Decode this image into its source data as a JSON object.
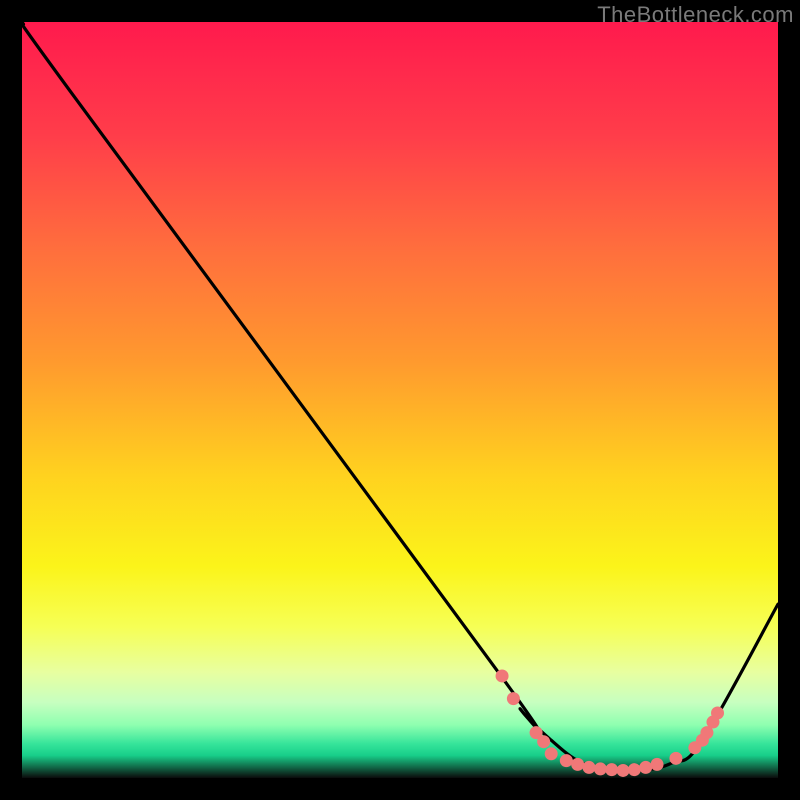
{
  "watermark": "TheBottleneck.com",
  "chart_data": {
    "type": "line",
    "title": "",
    "xlabel": "",
    "ylabel": "",
    "xlim": [
      0,
      100
    ],
    "ylim": [
      0,
      100
    ],
    "series": [
      {
        "name": "curve",
        "x": [
          0,
          7,
          63,
          66,
          70,
          74,
          78,
          82,
          86,
          90,
          100
        ],
        "y": [
          100,
          90,
          14,
          9,
          5,
          2,
          1,
          1,
          2,
          5,
          23
        ]
      }
    ],
    "markers": {
      "name": "highlight-dots",
      "color": "#f07878",
      "points": [
        {
          "x": 63.5,
          "y": 13.5
        },
        {
          "x": 65.0,
          "y": 10.5
        },
        {
          "x": 68.0,
          "y": 6.0
        },
        {
          "x": 69.0,
          "y": 4.8
        },
        {
          "x": 70.0,
          "y": 3.2
        },
        {
          "x": 72.0,
          "y": 2.3
        },
        {
          "x": 73.5,
          "y": 1.8
        },
        {
          "x": 75.0,
          "y": 1.4
        },
        {
          "x": 76.5,
          "y": 1.2
        },
        {
          "x": 78.0,
          "y": 1.1
        },
        {
          "x": 79.5,
          "y": 1.0
        },
        {
          "x": 81.0,
          "y": 1.1
        },
        {
          "x": 82.5,
          "y": 1.4
        },
        {
          "x": 84.0,
          "y": 1.8
        },
        {
          "x": 86.5,
          "y": 2.6
        },
        {
          "x": 89.0,
          "y": 4.0
        },
        {
          "x": 90.0,
          "y": 5.0
        },
        {
          "x": 90.6,
          "y": 6.0
        },
        {
          "x": 91.4,
          "y": 7.4
        },
        {
          "x": 92.0,
          "y": 8.6
        }
      ]
    },
    "gradient_bands": [
      {
        "stop": 0.0,
        "color": "#ff1a4d"
      },
      {
        "stop": 0.15,
        "color": "#ff3d4a"
      },
      {
        "stop": 0.3,
        "color": "#ff6e3d"
      },
      {
        "stop": 0.45,
        "color": "#ff9a2e"
      },
      {
        "stop": 0.6,
        "color": "#ffd21f"
      },
      {
        "stop": 0.72,
        "color": "#fbf41a"
      },
      {
        "stop": 0.8,
        "color": "#f6ff55"
      },
      {
        "stop": 0.86,
        "color": "#e8ffa0"
      },
      {
        "stop": 0.9,
        "color": "#c7ffc0"
      },
      {
        "stop": 0.93,
        "color": "#8effb0"
      },
      {
        "stop": 0.955,
        "color": "#35e49a"
      },
      {
        "stop": 0.97,
        "color": "#18cf8a"
      },
      {
        "stop": 1.0,
        "color": "#0b0b0b"
      }
    ]
  }
}
